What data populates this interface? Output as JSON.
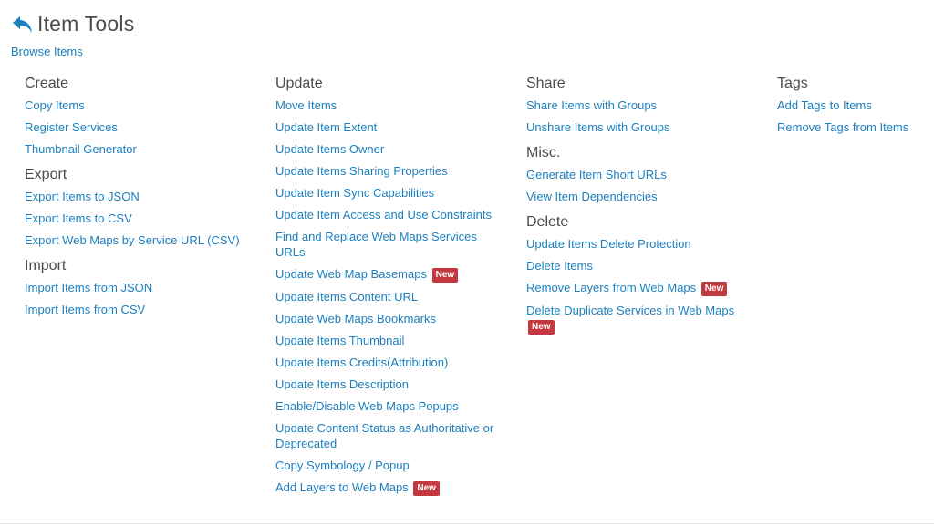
{
  "header": {
    "title": "Item Tools",
    "browse_label": "Browse Items"
  },
  "badge_label": "New",
  "colors": {
    "link": "#1c7fbe",
    "badge": "#c4393f",
    "heading": "#4c4c4c"
  },
  "columns": [
    {
      "groups": [
        {
          "title": "Create",
          "items": [
            {
              "label": "Copy Items"
            },
            {
              "label": "Register Services"
            },
            {
              "label": "Thumbnail Generator"
            }
          ]
        },
        {
          "title": "Export",
          "items": [
            {
              "label": "Export Items to JSON"
            },
            {
              "label": "Export Items to CSV"
            },
            {
              "label": "Export Web Maps by Service URL (CSV)"
            }
          ]
        },
        {
          "title": "Import",
          "items": [
            {
              "label": "Import Items from JSON"
            },
            {
              "label": "Import Items from CSV"
            }
          ]
        }
      ]
    },
    {
      "groups": [
        {
          "title": "Update",
          "items": [
            {
              "label": "Move Items"
            },
            {
              "label": "Update Item Extent"
            },
            {
              "label": "Update Items Owner"
            },
            {
              "label": "Update Items Sharing Properties"
            },
            {
              "label": "Update Item Sync Capabilities"
            },
            {
              "label": "Update Item Access and Use Constraints"
            },
            {
              "label": "Find and Replace Web Maps Services URLs"
            },
            {
              "label": "Update Web Map Basemaps",
              "new": true
            },
            {
              "label": "Update Items Content URL"
            },
            {
              "label": "Update Web Maps Bookmarks"
            },
            {
              "label": "Update Items Thumbnail"
            },
            {
              "label": "Update Items Credits(Attribution)"
            },
            {
              "label": "Update Items Description"
            },
            {
              "label": "Enable/Disable Web Maps Popups"
            },
            {
              "label": "Update Content Status as Authoritative or Deprecated"
            },
            {
              "label": "Copy Symbology / Popup"
            },
            {
              "label": "Add Layers to Web Maps",
              "new": true
            }
          ]
        }
      ]
    },
    {
      "groups": [
        {
          "title": "Share",
          "items": [
            {
              "label": "Share Items with Groups"
            },
            {
              "label": "Unshare Items with Groups"
            }
          ]
        },
        {
          "title": "Misc.",
          "items": [
            {
              "label": "Generate Item Short URLs"
            },
            {
              "label": "View Item Dependencies"
            }
          ]
        },
        {
          "title": "Delete",
          "items": [
            {
              "label": "Update Items Delete Protection"
            },
            {
              "label": "Delete Items"
            },
            {
              "label": "Remove Layers from Web Maps",
              "new": true
            },
            {
              "label": "Delete Duplicate Services in Web Maps",
              "new": true
            }
          ]
        }
      ]
    },
    {
      "groups": [
        {
          "title": "Tags",
          "items": [
            {
              "label": "Add Tags to Items"
            },
            {
              "label": "Remove Tags from Items"
            }
          ]
        }
      ]
    }
  ]
}
